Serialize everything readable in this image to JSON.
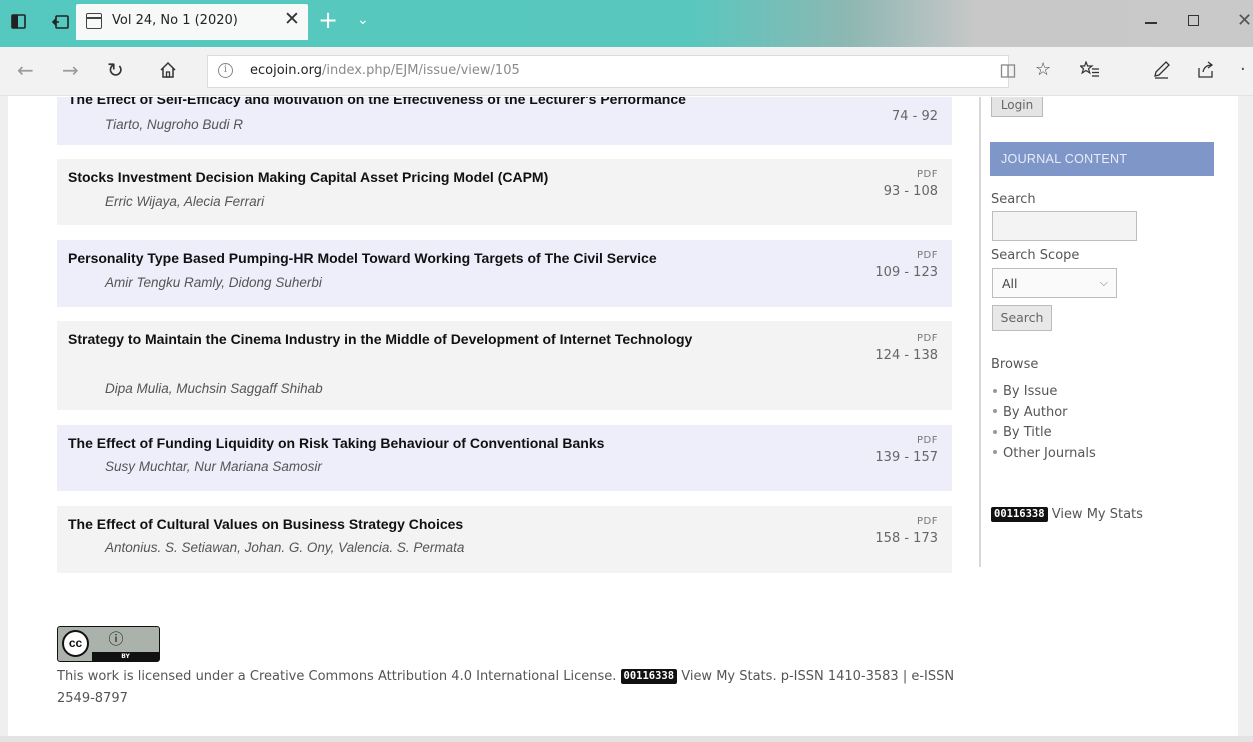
{
  "browser": {
    "tab_title": "Vol 24, No 1 (2020)",
    "tab_close": "✕",
    "new_tab": "+",
    "tab_menu": "⌄",
    "url_domain": "ecojoin.org",
    "url_path": "/index.php/EJM/issue/view/105",
    "window_close": "✕"
  },
  "articles": [
    {
      "title": "The Effect of Self-Efficacy and Motivation on the Effectiveness of the Lecturer's Performance",
      "authors": "Tiarto, Nugroho Budi R",
      "pdf": "",
      "pages": "74 - 92"
    },
    {
      "title": "Stocks Investment Decision Making Capital Asset Pricing Model (CAPM)",
      "authors": "Erric Wijaya, Alecia Ferrari",
      "pdf": "PDF",
      "pages": "93 - 108"
    },
    {
      "title": "Personality Type Based Pumping-HR Model Toward Working Targets of The Civil Service",
      "authors": "Amir Tengku Ramly, Didong Suherbi",
      "pdf": "PDF",
      "pages": "109 - 123"
    },
    {
      "title": "Strategy to Maintain the Cinema Industry in the Middle of Development of Internet Technology",
      "authors": "Dipa Mulia, Muchsin Saggaff Shihab",
      "pdf": "PDF",
      "pages": "124 - 138"
    },
    {
      "title": "The Effect of Funding Liquidity on Risk Taking Behaviour of Conventional Banks",
      "authors": "Susy Muchtar, Nur Mariana Samosir",
      "pdf": "PDF",
      "pages": "139 - 157"
    },
    {
      "title": "The Effect of Cultural Values on Business Strategy Choices",
      "authors": "Antonius. S. Setiawan, Johan. G. Ony, Valencia. S. Permata",
      "pdf": "PDF",
      "pages": "158 - 173"
    }
  ],
  "sidebar": {
    "login_label": "Login",
    "journal_content_header": "JOURNAL CONTENT",
    "search_label": "Search",
    "search_value": "",
    "search_scope_label": "Search Scope",
    "search_scope_value": "All",
    "search_button": "Search",
    "browse_label": "Browse",
    "browse_items": [
      "By Issue",
      "By Author",
      "By Title",
      "Other Journals"
    ],
    "counter": "00116338",
    "stats_link": "View My Stats"
  },
  "footer": {
    "cc_label": "cc",
    "cc_by_label": "BY",
    "license_prefix": "This work is licensed under a ",
    "license_link": "Creative Commons Attribution 4.0 International License",
    "license_suffix": ". ",
    "counter": "00116338",
    "stats_link": "View My Stats",
    "issn": ". p-ISSN 1410-3583 | e-ISSN 2549-8797"
  },
  "colors": {
    "titlebar": "#55c9bf",
    "row_odd": "#eeeefb",
    "row_even": "#f3f3f3",
    "journal_header": "#7f97c8"
  },
  "icons": [
    "tab-actions-icon",
    "set-aside-tabs-icon",
    "page-icon",
    "back-arrow-icon",
    "forward-arrow-icon",
    "refresh-icon",
    "home-icon",
    "info-icon",
    "reading-view-icon",
    "favorite-star-icon",
    "favorites-hub-icon",
    "pen-icon",
    "share-icon",
    "more-icon"
  ]
}
